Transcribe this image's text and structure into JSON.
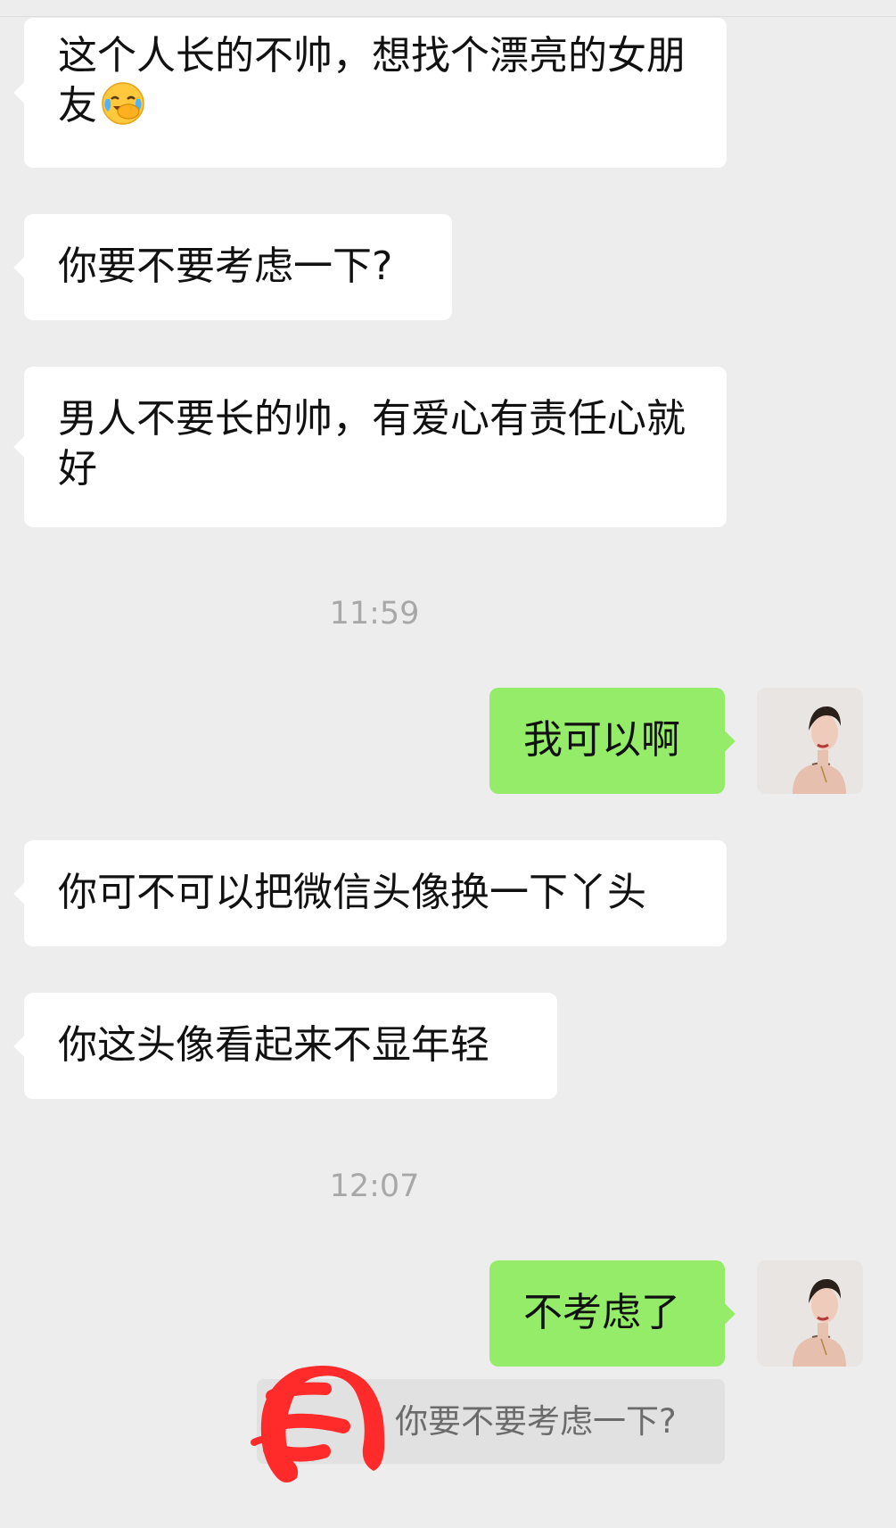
{
  "colors": {
    "background": "#ededed",
    "incoming_bubble": "#ffffff",
    "outgoing_bubble": "#95ec69",
    "timestamp_text": "#a8a8a8",
    "quote_background": "#e1e1e1",
    "redaction": "#ff3b30"
  },
  "messages": [
    {
      "side": "in",
      "text": "这个人长的不帅，想找个漂亮的女朋友",
      "emoji": "laughing-crying-face-icon"
    },
    {
      "side": "in",
      "text": "你要不要考虑一下?"
    },
    {
      "side": "in",
      "text": "男人不要长的帅，有爱心有责任心就好"
    },
    {
      "type": "time",
      "text": "11:59"
    },
    {
      "side": "out",
      "text": "我可以啊"
    },
    {
      "side": "in",
      "text": "你可不可以把微信头像换一下丫头"
    },
    {
      "side": "in",
      "text": "你这头像看起来不显年轻"
    },
    {
      "type": "time",
      "text": "12:07"
    },
    {
      "side": "out",
      "text": "不考虑了"
    }
  ],
  "quote": {
    "text": "你要不要考虑一下?"
  }
}
